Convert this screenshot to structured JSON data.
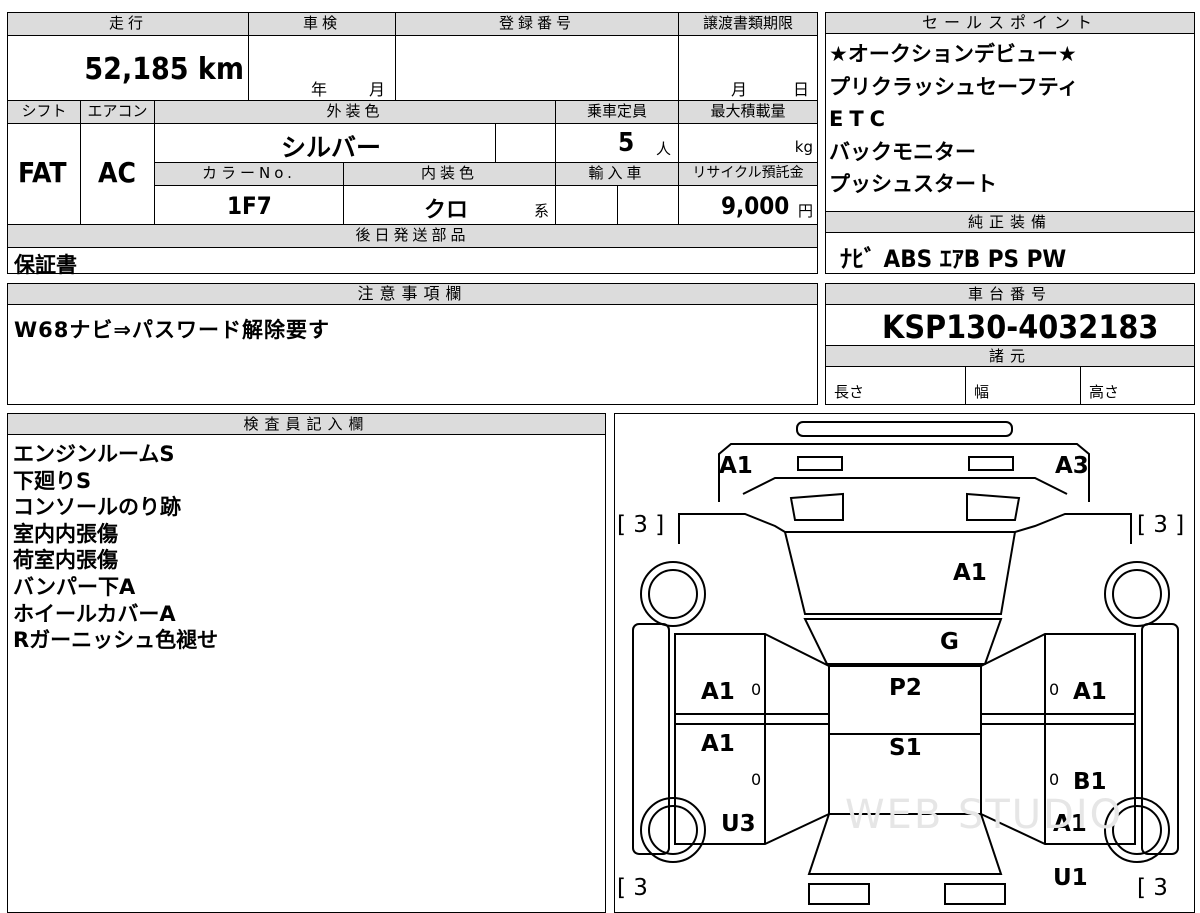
{
  "top_table": {
    "mileage_label": "走行",
    "mileage": "52,185 km",
    "shaken_label": "車検",
    "shaken_year": "年",
    "shaken_month": "月",
    "reg_label": "登録番号",
    "transfer_label": "譲渡書類期限",
    "transfer_month": "月",
    "transfer_day": "日",
    "shift_label": "シフト",
    "ac_label": "エアコン",
    "exterior_label": "外装色",
    "capacity_label": "乗車定員",
    "maxload_label": "最大積載量",
    "shift": "FAT",
    "ac": "AC",
    "exterior_color": "シルバー",
    "capacity": "5",
    "capacity_unit": "人",
    "maxload_unit": "kg",
    "color_no_label": "カラーNo.",
    "interior_label": "内装色",
    "import_label": "輸入車",
    "recycle_label": "リサイクル預託金",
    "color_no": "1F7",
    "interior_color": "クロ",
    "interior_suffix": "系",
    "recycle_fee": "9,000",
    "recycle_unit": "円",
    "later_parts_label": "後日発送部品",
    "later_parts": "保証書"
  },
  "sales": {
    "label": "セールスポイント",
    "items": [
      "★オークションデビュー★",
      "プリクラッシュセーフティ",
      "ETC",
      "バックモニター",
      "プッシュスタート"
    ]
  },
  "equipment": {
    "label": "純正装備",
    "value": "ﾅﾋﾞ ABS ｴｱB PS PW"
  },
  "notes": {
    "label": "注意事項欄",
    "text": "W68ナビ⇒パスワード解除要す"
  },
  "chassis": {
    "label": "車台番号",
    "value": "KSP130-4032183",
    "spec_label": "諸元",
    "length_label": "長さ",
    "width_label": "幅",
    "height_label": "高さ"
  },
  "inspector": {
    "label": "検査員記入欄",
    "items": [
      "エンジンルームS",
      "下廻りS",
      "コンソールのり跡",
      "室内内張傷",
      "荷室内張傷",
      "バンパー下A",
      "ホイールカバーA",
      "Rガーニッシュ色褪せ"
    ]
  },
  "diagram": {
    "marks": {
      "front_left": "A1",
      "front_right": "A3",
      "hood": "A1",
      "windshield": "G",
      "roof_front": "P2",
      "roof_rear": "S1",
      "left_front_door": "A1",
      "left_rear_door": "A1",
      "right_front_door": "A1",
      "right_rear_door": "B1",
      "left_rear_quarter": "U3",
      "right_rear_quarter": "A1",
      "right_rear_corner": "U1",
      "tire_top_left": "[ 3 ]",
      "tire_top_right": "[ 3 ]",
      "tire_bottom_left": "[ 3",
      "tire_bottom_right": "[ 3",
      "zero_mark": "0"
    },
    "watermark": "WEB STUDIO"
  }
}
